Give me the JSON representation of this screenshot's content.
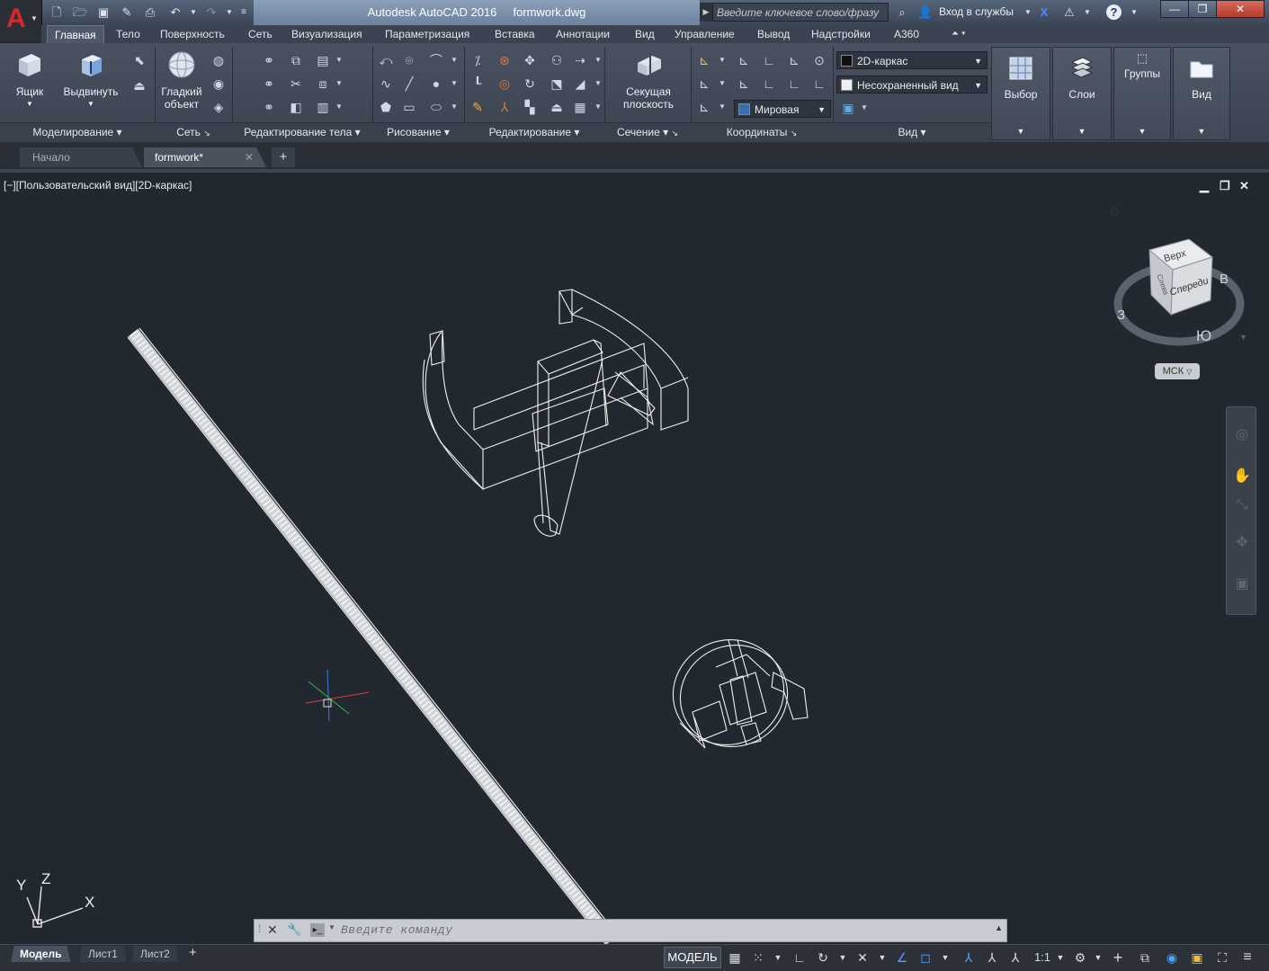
{
  "titlebar": {
    "app_name": "Autodesk AutoCAD 2016",
    "file_name": "formwork.dwg",
    "search_placeholder": "Введите ключевое слово/фразу",
    "signin_label": "Вход в службы",
    "app_menu_letter": "A"
  },
  "ribbon_tabs": [
    "Главная",
    "Тело",
    "Поверхность",
    "Сеть",
    "Визуализация",
    "Параметризация",
    "Вставка",
    "Аннотации",
    "Вид",
    "Управление",
    "Вывод",
    "Надстройки",
    "A360"
  ],
  "active_tab": "Главная",
  "ribbon": {
    "big_buttons": {
      "box": "Ящик",
      "extrude": "Выдвинуть",
      "smooth_line1": "Гладкий",
      "smooth_line2": "объект",
      "section_line1": "Секущая",
      "section_line2": "плоскость"
    },
    "panels": {
      "modeling": "Моделирование",
      "mesh": "Сеть",
      "solid_editing": "Редактирование тела",
      "draw": "Рисование",
      "modify": "Редактирование",
      "section": "Сечение",
      "coordinates": "Координаты",
      "view": "Вид"
    },
    "visual_style": "2D-каркас",
    "named_view": "Несохраненный вид",
    "ucs_world": "Мировая",
    "right_panels": {
      "selection": "Выбор",
      "layers": "Слои",
      "groups": "Группы",
      "view": "Вид"
    }
  },
  "doc_tabs": {
    "start": "Начало",
    "file": "formwork*",
    "add": "+"
  },
  "viewport": {
    "label": "[−][Пользовательский вид][2D-каркас]",
    "viewcube": {
      "top": "Верх",
      "front": "Спереди",
      "left": "Слева",
      "compass_w": "З",
      "compass_e": "В",
      "compass_s": "Ю"
    },
    "wcs_label": "МСК",
    "ucs_icon": {
      "x": "X",
      "y": "Y",
      "z": "Z"
    }
  },
  "command_line": {
    "placeholder": "Введите команду"
  },
  "layout_tabs": [
    "Модель",
    "Лист1",
    "Лист2"
  ],
  "layout_add": "+",
  "statusbar": {
    "model": "МОДЕЛЬ",
    "scale": "1:1"
  },
  "colors": {
    "canvas": "#212830",
    "ribbon": "#444b59",
    "accent_red": "#d8262f",
    "title_highlight": "#7d92ad"
  }
}
